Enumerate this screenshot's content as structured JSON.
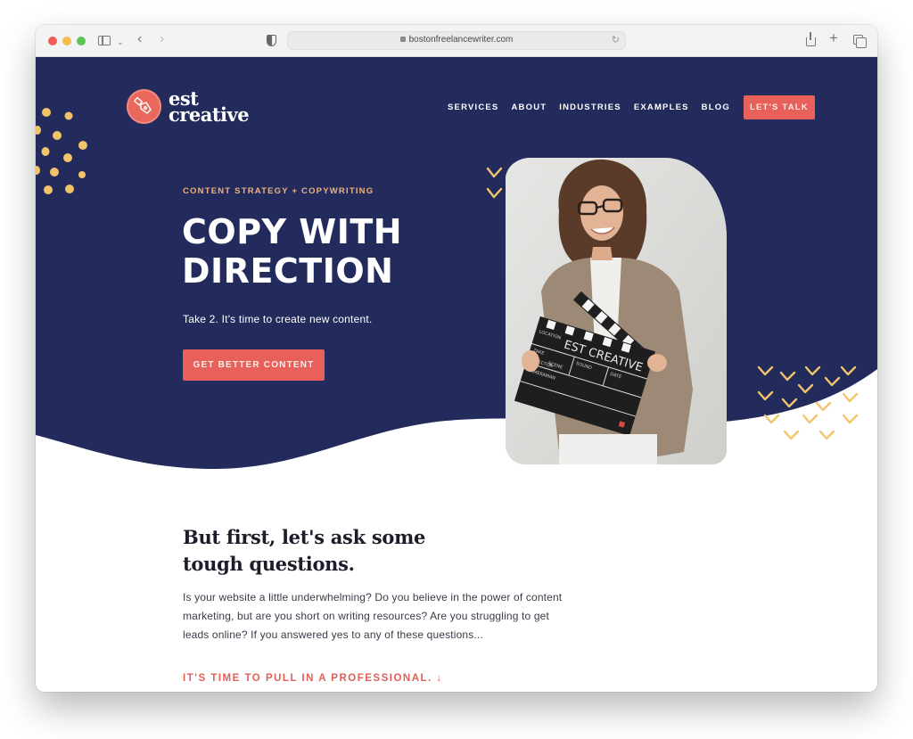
{
  "browser": {
    "url": "bostonfreelancewriter.com",
    "icons": [
      "sidebar-icon",
      "chevron-down-icon",
      "back-icon",
      "forward-icon",
      "privacy-shield-icon",
      "lock-icon",
      "reload-icon",
      "share-icon",
      "new-tab-icon",
      "tab-overview-icon"
    ]
  },
  "colors": {
    "navy": "#222b5c",
    "coral": "#e8605a",
    "gold": "#f2c46a",
    "eyebrow": "#f0b27a"
  },
  "header": {
    "logo_line1": "est",
    "logo_line2": "creative",
    "logo_icon": "pen-nib-icon",
    "nav": [
      {
        "label": "SERVICES"
      },
      {
        "label": "ABOUT"
      },
      {
        "label": "INDUSTRIES"
      },
      {
        "label": "EXAMPLES"
      },
      {
        "label": "BLOG"
      }
    ],
    "cta_label": "LET'S TALK"
  },
  "hero": {
    "eyebrow": "CONTENT STRATEGY + COPYWRITING",
    "title_line1": "COPY WITH",
    "title_line2": "DIRECTION",
    "subtitle": "Take 2. It's time to create new content.",
    "cta_label": "GET BETTER CONTENT",
    "photo_alt": "Woman in glasses and blazer holding a clapperboard",
    "clapper_text": "EST CREATIVE",
    "clapper_fields": [
      "LOCATION",
      "TAKE",
      "SCENE",
      "SOUND",
      "DIRECTOR",
      "DATE",
      "CAMERAMAN"
    ]
  },
  "intro": {
    "title_line1": "But first, let's ask some",
    "title_line2": "tough questions.",
    "body": "Is your website a little underwhelming? Do you believe in the power of content marketing, but are you short on writing resources? Are you struggling to get leads online? If you answered yes to any of these questions...",
    "cta_label": "IT'S TIME TO PULL IN A PROFESSIONAL. ↓"
  }
}
